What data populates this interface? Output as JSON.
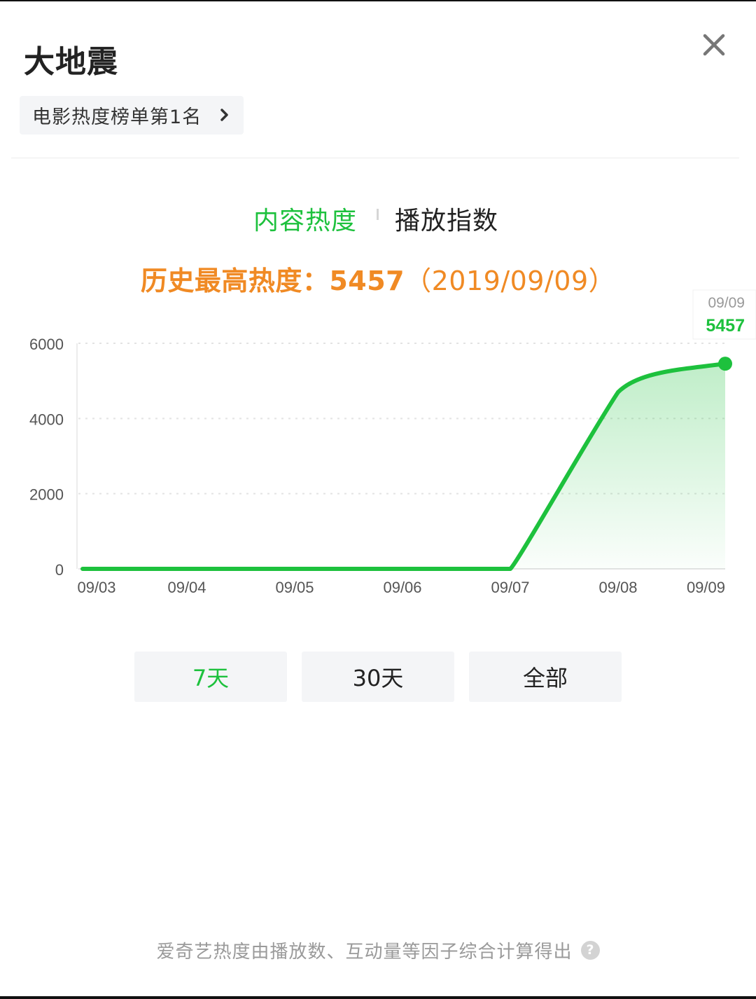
{
  "header": {
    "title": "大地震",
    "close_icon": "close-icon",
    "rank_label": "电影热度榜单第1名",
    "rank_chevron": "chevron-right-icon"
  },
  "tabs": [
    {
      "label": "内容热度",
      "active": true
    },
    {
      "label": "播放指数",
      "active": false
    }
  ],
  "peak": {
    "label": "历史最高热度：",
    "value": "5457",
    "date_text": "（2019/09/09）"
  },
  "colors": {
    "accent_green": "#1dc13d",
    "peak_orange": "#f08a24",
    "text_dark": "#222222",
    "text_gray": "#9a9a9a"
  },
  "chart_data": {
    "type": "line",
    "x": [
      "09/03",
      "09/04",
      "09/05",
      "09/06",
      "09/07",
      "09/08",
      "09/09"
    ],
    "series": [
      {
        "values": [
          0,
          0,
          0,
          0,
          0,
          4700,
          5457
        ]
      }
    ],
    "ylim": [
      0,
      6000
    ],
    "yticks": [
      0,
      2000,
      4000,
      6000
    ],
    "grid": true,
    "area_fill": true,
    "tooltip": {
      "date": "09/09",
      "value": "5457"
    }
  },
  "ranges": [
    {
      "label": "7天",
      "active": true
    },
    {
      "label": "30天",
      "active": false
    },
    {
      "label": "全部",
      "active": false
    }
  ],
  "footer": {
    "text": "爱奇艺热度由播放数、互动量等因子综合计算得出",
    "help_icon": "question-icon",
    "help_glyph": "?"
  }
}
